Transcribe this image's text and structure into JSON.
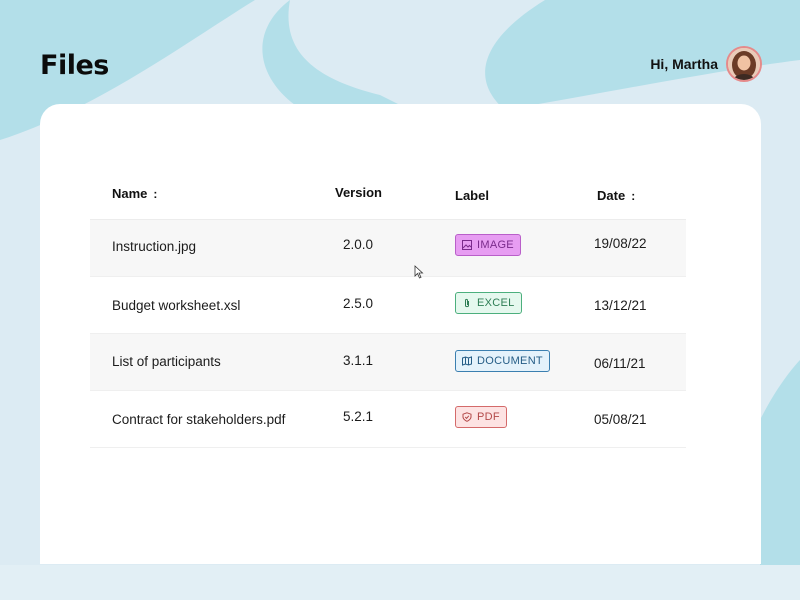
{
  "header": {
    "title": "Files",
    "greeting": "Hi, Martha",
    "avatar_icon": "user-avatar"
  },
  "table": {
    "columns": {
      "name": "Name",
      "version": "Version",
      "label": "Label",
      "date": "Date"
    },
    "sort_glyph": ":",
    "rows": [
      {
        "name": "Instruction.jpg",
        "version": "2.0.0",
        "label": "IMAGE",
        "label_icon": "image-icon",
        "date": "19/08/22"
      },
      {
        "name": "Budget worksheet.xsl",
        "version": "2.5.0",
        "label": "EXCEL",
        "label_icon": "paperclip-icon",
        "date": "13/12/21"
      },
      {
        "name": "List of participants",
        "version": "3.1.1",
        "label": "DOCUMENT",
        "label_icon": "map-icon",
        "date": "06/11/21"
      },
      {
        "name": "Contract for stakeholders.pdf",
        "version": "5.2.1",
        "label": "PDF",
        "label_icon": "shield-icon",
        "date": "05/08/21"
      }
    ]
  },
  "colors": {
    "background": "#dcebf3",
    "wave": "#b3dfe9",
    "image_badge_bg": "#e79df2",
    "image_badge_border": "#b95fc9",
    "excel_badge_bg": "#e5f8ee",
    "excel_badge_border": "#4caf7d",
    "document_badge_bg": "#e4f2fb",
    "document_badge_border": "#3b7fb0",
    "pdf_badge_bg": "#fde3e3",
    "pdf_badge_border": "#d46a6a"
  }
}
